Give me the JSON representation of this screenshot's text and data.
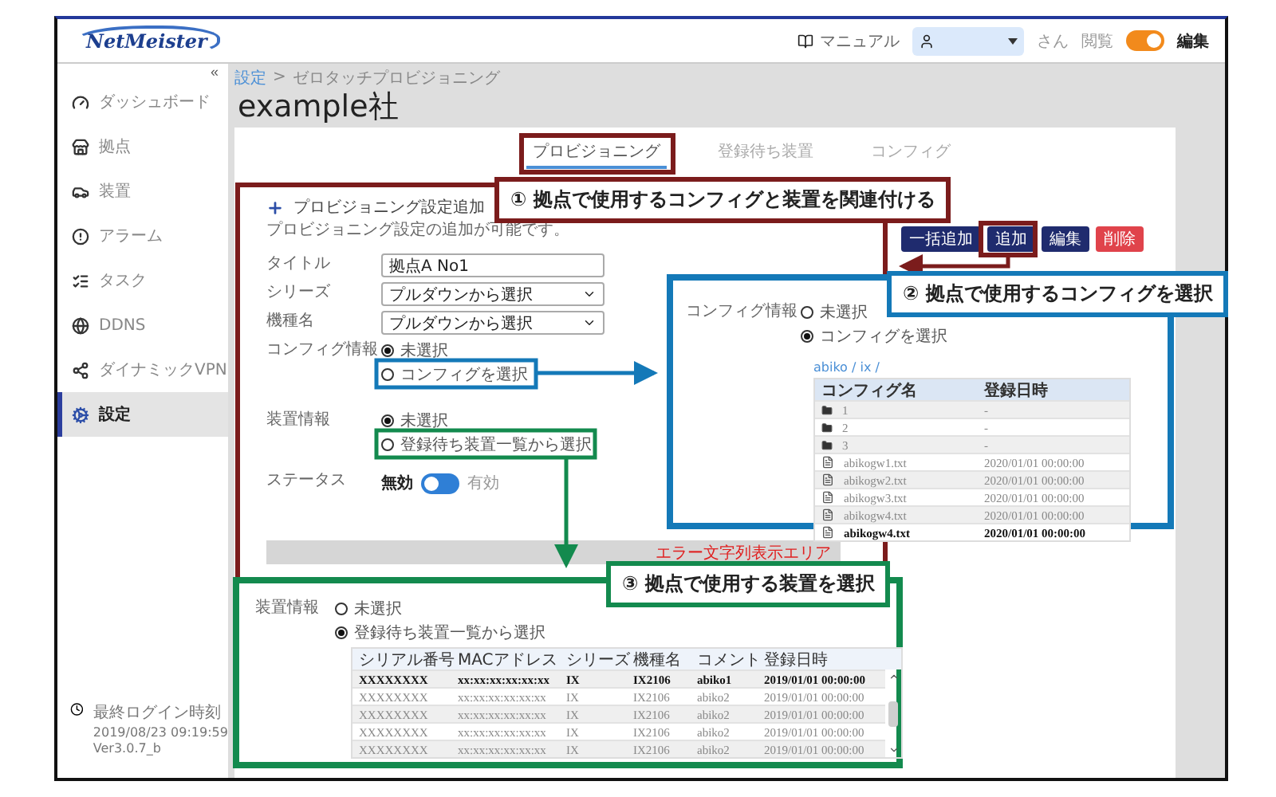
{
  "header": {
    "logo": "NetMeister",
    "manual": "マニュアル",
    "user_suffix": "さん",
    "view_label": "閲覧",
    "edit_label": "編集",
    "edit_mode": true
  },
  "sidebar": {
    "collapse": "«",
    "items": [
      {
        "label": "ダッシュボード",
        "selected": false
      },
      {
        "label": "拠点",
        "selected": false
      },
      {
        "label": "装置",
        "selected": false
      },
      {
        "label": "アラーム",
        "selected": false
      },
      {
        "label": "タスク",
        "selected": false
      },
      {
        "label": "DDNS",
        "selected": false
      },
      {
        "label": "ダイナミックVPN",
        "selected": false
      },
      {
        "label": "設定",
        "selected": true
      }
    ],
    "last_login": {
      "label": "最終ログイン時刻",
      "time": "2019/08/23 09:19:59",
      "version": "Ver3.0.7_b"
    }
  },
  "breadcrumb": {
    "items": [
      "設定",
      "ゼロタッチプロビジョニング"
    ],
    "separator": ">"
  },
  "page_title": "example社",
  "tabs": [
    {
      "label": "プロビジョニング",
      "selected": true
    },
    {
      "label": "登録待ち装置",
      "selected": false
    },
    {
      "label": "コンフィグ",
      "selected": false
    }
  ],
  "actions": [
    {
      "label": "一括追加",
      "kind": "primary"
    },
    {
      "label": "追加",
      "kind": "primary"
    },
    {
      "label": "編集",
      "kind": "primary"
    },
    {
      "label": "削除",
      "kind": "danger"
    }
  ],
  "form": {
    "heading": "プロビジョニング設定追加",
    "description": "プロビジョニング設定の追加が可能です。",
    "fields": [
      {
        "kind": "text",
        "label": "タイトル",
        "value": "拠点A No1"
      },
      {
        "kind": "select",
        "label": "シリーズ",
        "value": "プルダウンから選択"
      },
      {
        "kind": "select",
        "label": "機種名",
        "value": "プルダウンから選択"
      },
      {
        "kind": "radio",
        "label": "コンフィグ情報",
        "options": [
          {
            "label": "未選択",
            "selected": true
          },
          {
            "label": "コンフィグを選択",
            "selected": false
          }
        ]
      },
      {
        "kind": "radio",
        "label": "装置情報",
        "options": [
          {
            "label": "未選択",
            "selected": true
          },
          {
            "label": "登録待ち装置一覧から選択",
            "selected": false
          }
        ]
      },
      {
        "kind": "toggle",
        "label": "ステータス",
        "off_label": "無効",
        "on_label": "有効",
        "on": false
      }
    ],
    "error": "エラー文字列表示エリア"
  },
  "callouts": [
    {
      "text": "① 拠点で使用するコンフィグと装置を関連付ける",
      "color": "#7b1c1c"
    },
    {
      "text": "② 拠点で使用するコンフィグを選択",
      "color": "#1479b8"
    },
    {
      "text": "③ 拠点で使用する装置を選択",
      "color": "#138a4e"
    }
  ],
  "config_panel": {
    "label": "コンフィグ情報",
    "options": [
      {
        "label": "未選択",
        "selected": false
      },
      {
        "label": "コンフィグを選択",
        "selected": true
      }
    ],
    "path": "abiko / ix /",
    "columns": [
      "コンフィグ名",
      "登録日時"
    ],
    "rows": [
      {
        "kind": "folder",
        "name": "1",
        "date": "-",
        "selected": false
      },
      {
        "kind": "folder",
        "name": "2",
        "date": "-",
        "selected": false
      },
      {
        "kind": "folder",
        "name": "3",
        "date": "-",
        "selected": false
      },
      {
        "kind": "file",
        "name": "abikogw1.txt",
        "date": "2020/01/01 00:00:00",
        "selected": false
      },
      {
        "kind": "file",
        "name": "abikogw2.txt",
        "date": "2020/01/01 00:00:00",
        "selected": false
      },
      {
        "kind": "file",
        "name": "abikogw3.txt",
        "date": "2020/01/01 00:00:00",
        "selected": false
      },
      {
        "kind": "file",
        "name": "abikogw4.txt",
        "date": "2020/01/01 00:00:00",
        "selected": false
      },
      {
        "kind": "file",
        "name": "abikogw4.txt",
        "date": "2020/01/01 00:00:00",
        "selected": true
      }
    ]
  },
  "device_panel": {
    "label": "装置情報",
    "options": [
      {
        "label": "未選択",
        "selected": false
      },
      {
        "label": "登録待ち装置一覧から選択",
        "selected": true
      }
    ],
    "columns": [
      "シリアル番号",
      "MACアドレス",
      "シリーズ",
      "機種名",
      "コメント",
      "登録日時"
    ],
    "rows": [
      {
        "cells": [
          "XXXXXXXX",
          "xx:xx:xx:xx:xx:xx",
          "IX",
          "IX2106",
          "abiko1",
          "2019/01/01 00:00:00"
        ],
        "selected": true
      },
      {
        "cells": [
          "XXXXXXXX",
          "xx:xx:xx:xx:xx:xx",
          "IX",
          "IX2106",
          "abiko2",
          "2019/01/01 00:00:00"
        ],
        "selected": false
      },
      {
        "cells": [
          "XXXXXXXX",
          "xx:xx:xx:xx:xx:xx",
          "IX",
          "IX2106",
          "abiko2",
          "2019/01/01 00:00:00"
        ],
        "selected": false
      },
      {
        "cells": [
          "XXXXXXXX",
          "xx:xx:xx:xx:xx:xx",
          "IX",
          "IX2106",
          "abiko2",
          "2019/01/01 00:00:00"
        ],
        "selected": false
      },
      {
        "cells": [
          "XXXXXXXX",
          "xx:xx:xx:xx:xx:xx",
          "IX",
          "IX2106",
          "abiko2",
          "2019/01/01 00:00:00"
        ],
        "selected": false
      }
    ]
  }
}
